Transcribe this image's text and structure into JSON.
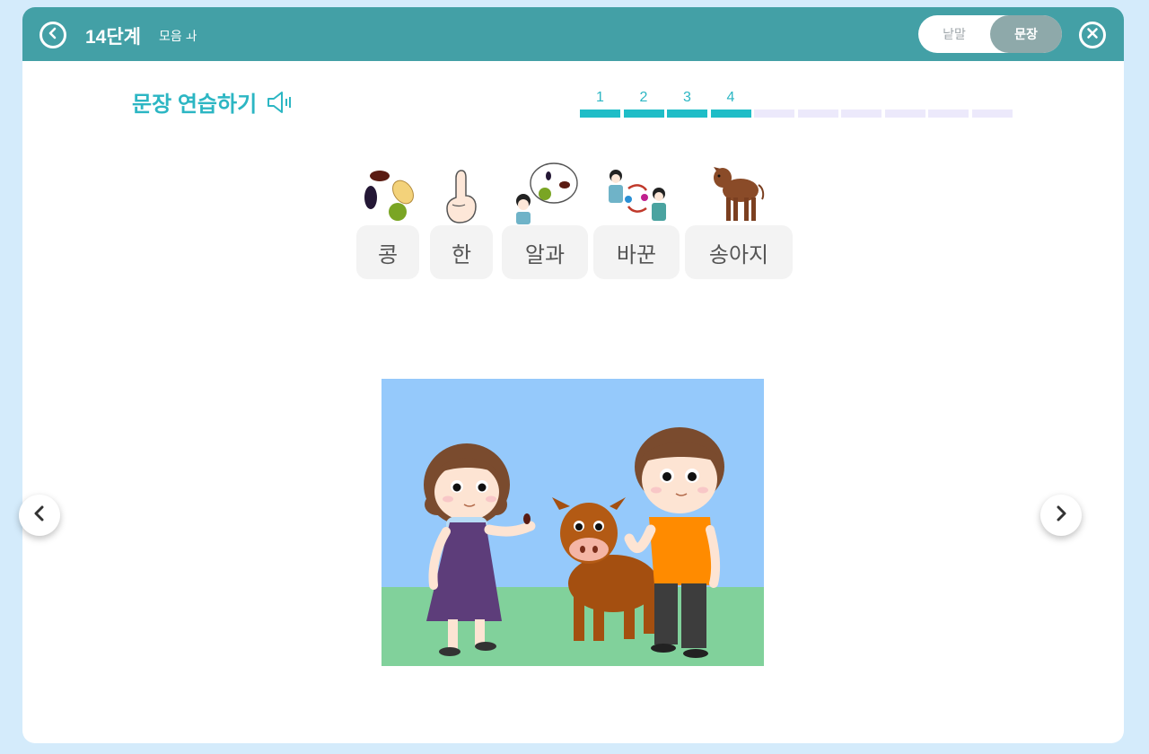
{
  "header": {
    "step_title": "14단계",
    "step_subtitle": "모음 ㅘ",
    "toggle": {
      "word_label": "낱말",
      "sentence_label": "문장",
      "active": "sentence"
    },
    "back_icon": "chevron-left-circle-icon",
    "close_icon": "close-circle-icon"
  },
  "practice": {
    "title": "문장 연습하기",
    "speaker_icon": "speaker-icon",
    "progress": {
      "numbers": [
        "1",
        "2",
        "3",
        "4"
      ],
      "completed": 4,
      "total": 10
    }
  },
  "symbols": [
    {
      "word": "콩",
      "icon": "beans-icon"
    },
    {
      "word": "한",
      "icon": "one-finger-icon"
    },
    {
      "word": "알과",
      "icon": "counting-beans-icon"
    },
    {
      "word": "바꾼",
      "icon": "exchange-icon"
    },
    {
      "word": "송아지",
      "icon": "calf-icon"
    }
  ],
  "scene": {
    "description_icon": "girl-boy-calf-illustration"
  },
  "navigation": {
    "prev_icon": "chevron-left-icon",
    "next_icon": "chevron-right-icon"
  },
  "colors": {
    "header": "#43a0a6",
    "accent": "#2cb6c3",
    "progress_done": "#1fbdc7",
    "progress_todo": "#ece9fb",
    "page_bg": "#d4ebfb"
  }
}
